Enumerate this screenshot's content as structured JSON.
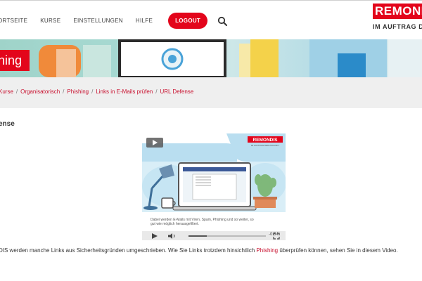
{
  "nav": {
    "items": [
      "ORTSEITE",
      "KURSE",
      "EINSTELLUNGEN",
      "HILFE"
    ],
    "logout_label": "LOGOUT"
  },
  "logo": {
    "brand": "REMONDIS",
    "tagline": "IM AUFTRAG DE"
  },
  "banner": {
    "title": "hing"
  },
  "breadcrumb": [
    "Kurse",
    "Organisatorisch",
    "Phishing",
    "Links in E-Mails prüfen",
    "URL Defense"
  ],
  "page": {
    "title": "ense"
  },
  "video": {
    "logo_text": "REMONDIS",
    "logo_sub": "IM AUFTRAG DER ZUKUNFT",
    "caption": "Dabei werden E-Mails mit Viren, Spam, Phishing und so weiter, so gut wie möglich herausgefiltert.",
    "time": "-0:34",
    "progress": 0.24
  },
  "description": {
    "before": "DIS werden manche Links aus Sicherheitsgründen umgeschrieben. Wie Sie Links trotzdem hinsichtlich ",
    "link": "Phishing",
    "after": " überprüfen können, sehen Sie in diesem Video."
  },
  "colors": {
    "accent": "#e3051b",
    "link": "#c8102e",
    "breadcrumb_bg": "#efefef"
  }
}
